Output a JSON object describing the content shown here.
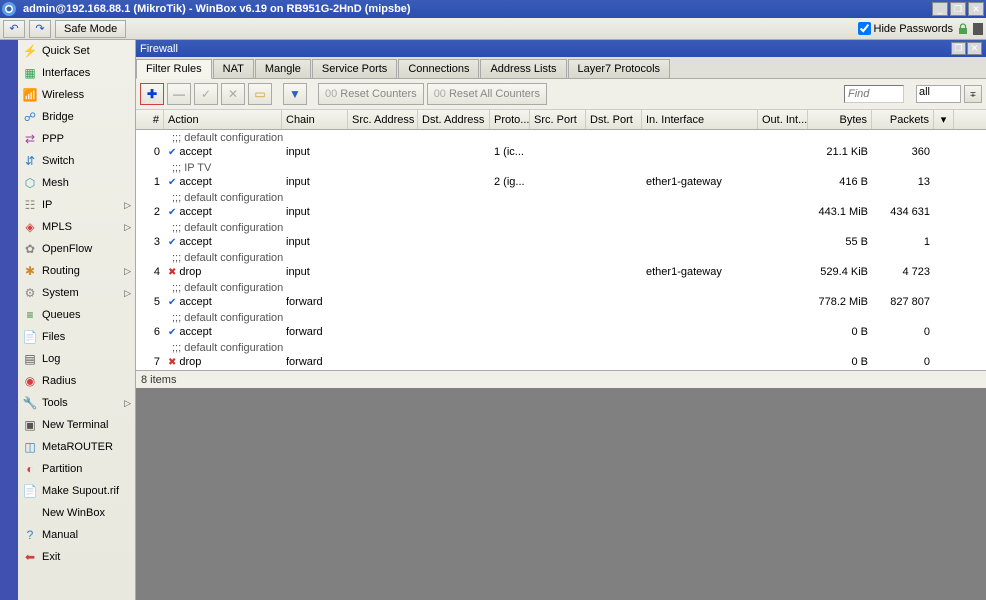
{
  "titlebar": {
    "text": "admin@192.168.88.1 (MikroTik) - WinBox v6.19 on RB951G-2HnD (mipsbe)"
  },
  "top_toolbar": {
    "safe_mode": "Safe Mode",
    "hide_passwords": "Hide Passwords"
  },
  "sidebar": {
    "items": [
      {
        "label": "Quick Set",
        "icon": "⚡",
        "color": "#d08830"
      },
      {
        "label": "Interfaces",
        "icon": "▦",
        "color": "#30a050"
      },
      {
        "label": "Wireless",
        "icon": "📶",
        "color": "#555"
      },
      {
        "label": "Bridge",
        "icon": "☍",
        "color": "#3080d0"
      },
      {
        "label": "PPP",
        "icon": "⇄",
        "color": "#a040a0"
      },
      {
        "label": "Switch",
        "icon": "⇵",
        "color": "#3080d0"
      },
      {
        "label": "Mesh",
        "icon": "⬡",
        "color": "#30a0a0"
      },
      {
        "label": "IP",
        "icon": "☷",
        "color": "#888",
        "arrow": true
      },
      {
        "label": "MPLS",
        "icon": "◈",
        "color": "#d04040",
        "arrow": true
      },
      {
        "label": "OpenFlow",
        "icon": "✿",
        "color": "#888"
      },
      {
        "label": "Routing",
        "icon": "✱",
        "color": "#d08830",
        "arrow": true
      },
      {
        "label": "System",
        "icon": "⚙",
        "color": "#888",
        "arrow": true
      },
      {
        "label": "Queues",
        "icon": "≡",
        "color": "#308030"
      },
      {
        "label": "Files",
        "icon": "📄",
        "color": "#555"
      },
      {
        "label": "Log",
        "icon": "▤",
        "color": "#555"
      },
      {
        "label": "Radius",
        "icon": "◉",
        "color": "#d04040"
      },
      {
        "label": "Tools",
        "icon": "🔧",
        "color": "#555",
        "arrow": true
      },
      {
        "label": "New Terminal",
        "icon": "▣",
        "color": "#555"
      },
      {
        "label": "MetaROUTER",
        "icon": "◫",
        "color": "#3080d0"
      },
      {
        "label": "Partition",
        "icon": "◐",
        "color": "#d04040"
      },
      {
        "label": "Make Supout.rif",
        "icon": "📄",
        "color": "#555"
      },
      {
        "label": "New WinBox",
        "icon": " ",
        "color": "#555"
      },
      {
        "label": "Manual",
        "icon": "?",
        "color": "#3080d0"
      },
      {
        "label": "Exit",
        "icon": "⬅",
        "color": "#d04040"
      }
    ]
  },
  "firewall": {
    "title": "Firewall",
    "tabs": [
      "Filter Rules",
      "NAT",
      "Mangle",
      "Service Ports",
      "Connections",
      "Address Lists",
      "Layer7 Protocols"
    ],
    "active_tab": 0,
    "toolbar": {
      "reset_counters": "Reset Counters",
      "reset_all_counters": "Reset All Counters",
      "find_placeholder": "Find",
      "filter_all": "all"
    },
    "columns": [
      "#",
      "Action",
      "Chain",
      "Src. Address",
      "Dst. Address",
      "Proto...",
      "Src. Port",
      "Dst. Port",
      "In. Interface",
      "Out. Int...",
      "Bytes",
      "Packets"
    ],
    "rows": [
      {
        "type": "comment",
        "text": ";;; default configuration"
      },
      {
        "type": "data",
        "num": "0",
        "action": "accept",
        "chain": "input",
        "proto": "1 (ic...",
        "bytes": "21.1 KiB",
        "packets": "360"
      },
      {
        "type": "comment",
        "text": ";;; IP TV"
      },
      {
        "type": "data",
        "num": "1",
        "action": "accept",
        "chain": "input",
        "proto": "2 (ig...",
        "inif": "ether1-gateway",
        "bytes": "416 B",
        "packets": "13"
      },
      {
        "type": "comment",
        "text": ";;; default configuration"
      },
      {
        "type": "data",
        "num": "2",
        "action": "accept",
        "chain": "input",
        "bytes": "443.1 MiB",
        "packets": "434 631"
      },
      {
        "type": "comment",
        "text": ";;; default configuration"
      },
      {
        "type": "data",
        "num": "3",
        "action": "accept",
        "chain": "input",
        "bytes": "55 B",
        "packets": "1"
      },
      {
        "type": "comment",
        "text": ";;; default configuration"
      },
      {
        "type": "data",
        "num": "4",
        "action": "drop",
        "chain": "input",
        "inif": "ether1-gateway",
        "bytes": "529.4 KiB",
        "packets": "4 723"
      },
      {
        "type": "comment",
        "text": ";;; default configuration"
      },
      {
        "type": "data",
        "num": "5",
        "action": "accept",
        "chain": "forward",
        "bytes": "778.2 MiB",
        "packets": "827 807"
      },
      {
        "type": "comment",
        "text": ";;; default configuration"
      },
      {
        "type": "data",
        "num": "6",
        "action": "accept",
        "chain": "forward",
        "bytes": "0 B",
        "packets": "0"
      },
      {
        "type": "comment",
        "text": ";;; default configuration"
      },
      {
        "type": "data",
        "num": "7",
        "action": "drop",
        "chain": "forward",
        "bytes": "0 B",
        "packets": "0"
      }
    ],
    "status": "8 items"
  }
}
